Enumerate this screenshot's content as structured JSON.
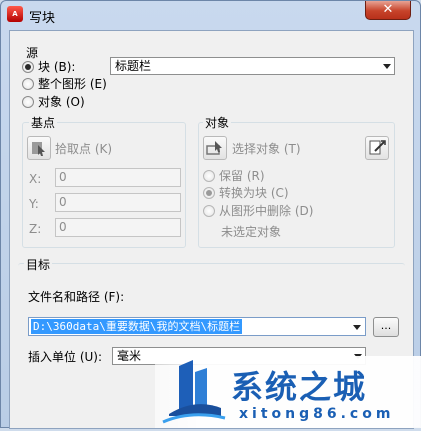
{
  "window": {
    "title": "写块",
    "close_glyph": "✕"
  },
  "source": {
    "legend": "源",
    "options": [
      {
        "label": "块 (B):",
        "checked": true
      },
      {
        "label": "整个图形 (E)",
        "checked": false
      },
      {
        "label": "对象 (O)",
        "checked": false
      }
    ],
    "block_select_value": "标题栏"
  },
  "base_point": {
    "legend": "基点",
    "pick_label": "拾取点 (K)",
    "x_label": "X:",
    "x_value": "0",
    "y_label": "Y:",
    "y_value": "0",
    "z_label": "Z:",
    "z_value": "0"
  },
  "objects": {
    "legend": "对象",
    "select_label": "选择对象 (T)",
    "options": [
      {
        "label": "保留 (R)",
        "checked": false
      },
      {
        "label": "转换为块 (C)",
        "checked": true
      },
      {
        "label": "从图形中删除 (D)",
        "checked": false
      }
    ],
    "status": "未选定对象"
  },
  "target": {
    "legend": "目标",
    "path_label": "文件名和路径 (F):",
    "path_value": "D:\\360data\\重要数据\\我的文档\\标题栏",
    "browse_label": "...",
    "units_label": "插入单位 (U):",
    "units_value": "毫米"
  },
  "watermark": {
    "name": "系统之城",
    "url": "xitong86.com"
  }
}
